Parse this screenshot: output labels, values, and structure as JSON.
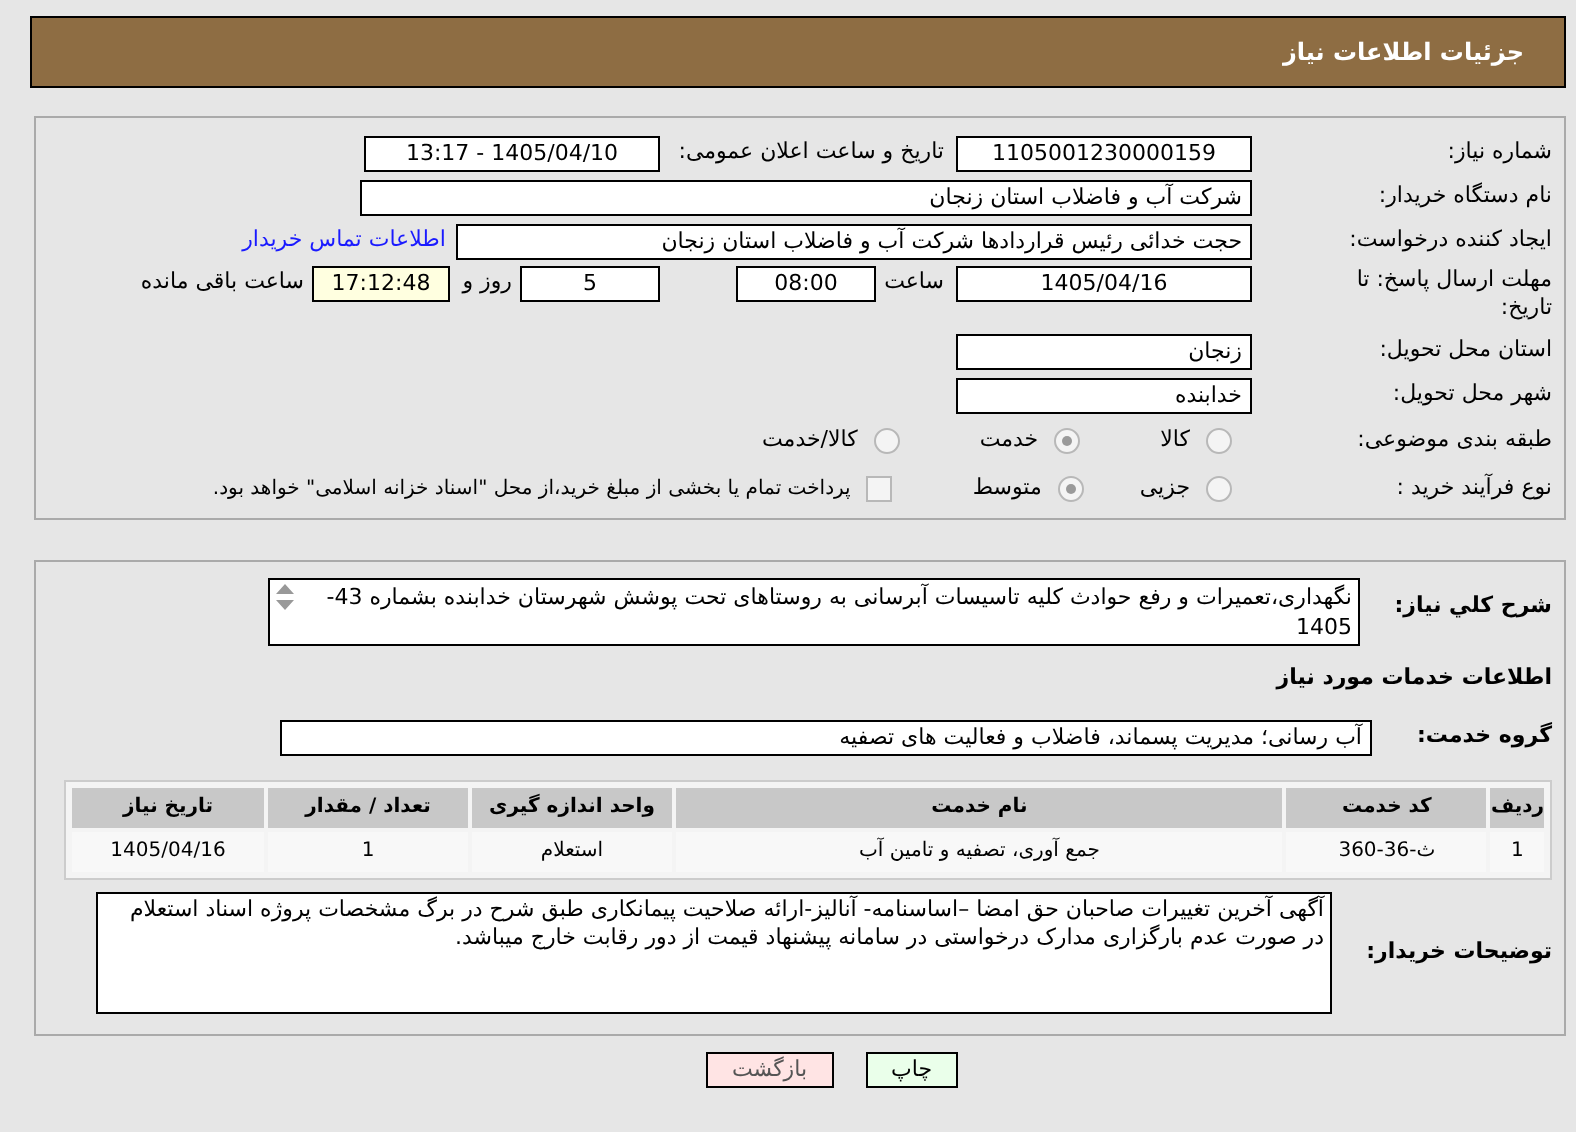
{
  "header": {
    "title": "جزئیات اطلاعات نیاز"
  },
  "need_number": {
    "label": "شماره نیاز:",
    "value": "1105001230000159"
  },
  "announce": {
    "label": "تاریخ و ساعت اعلان عمومی:",
    "value": "1405/04/10 - 13:17"
  },
  "buyer_org": {
    "label": "نام دستگاه خریدار:",
    "value": "شرکت آب و فاضلاب استان زنجان"
  },
  "requester": {
    "label": "ایجاد کننده درخواست:",
    "value": "حجت  خدائی رئیس قراردادها شرکت آب و فاضلاب استان زنجان",
    "link": "اطلاعات تماس خریدار"
  },
  "deadline": {
    "label": "مهلت ارسال پاسخ: تا تاریخ:",
    "date": "1405/04/16",
    "time_label": "ساعت",
    "time": "08:00",
    "days": "5",
    "days_label": "روز و",
    "remaining": "17:12:48",
    "remaining_label": "ساعت باقی مانده"
  },
  "province": {
    "label": "استان محل تحویل:",
    "value": "زنجان"
  },
  "city": {
    "label": "شهر محل تحویل:",
    "value": "خدابنده"
  },
  "category": {
    "label": "طبقه بندی موضوعی:",
    "options": [
      {
        "label": "کالا",
        "selected": false
      },
      {
        "label": "خدمت",
        "selected": true
      },
      {
        "label": "کالا/خدمت",
        "selected": false
      }
    ]
  },
  "process": {
    "label": "نوع فرآیند خرید :",
    "options": [
      {
        "label": "جزیی",
        "selected": false
      },
      {
        "label": "متوسط",
        "selected": true
      }
    ],
    "payment": {
      "label": "پرداخت تمام یا بخشی از مبلغ خرید،از محل \"اسناد خزانه اسلامی\" خواهد بود.",
      "checked": false
    }
  },
  "description": {
    "label": "شرح کلي نیاز:",
    "value": "نگهداری،تعمیرات و رفع حوادث کلیه تاسیسات آبرسانی به روستاهای تحت پوشش شهرستان خدابنده بشماره 43-1405"
  },
  "services_title": "اطلاعات خدمات مورد نیاز",
  "service_group": {
    "label": "گروه خدمت:",
    "value": "آب رسانی؛ مدیریت پسماند، فاضلاب و فعالیت های تصفیه"
  },
  "table": {
    "columns": [
      "ردیف",
      "کد خدمت",
      "نام خدمت",
      "واحد اندازه گیری",
      "تعداد / مقدار",
      "تاریخ نیاز"
    ],
    "rows": [
      [
        "1",
        "ث-36-360",
        "جمع آوری، تصفیه و تامین آب",
        "استعلام",
        "1",
        "1405/04/16"
      ]
    ]
  },
  "buyer_notes": {
    "label": "توضیحات خریدار:",
    "value": "آگهی آخرین تغییرات صاحبان حق امضا –اساسنامه- آنالیز-ارائه صلاحیت پیمانکاری طبق شرح در برگ مشخصات پروژه اسناد استعلام در صورت عدم بارگزاری مدارک درخواستی در سامانه پیشنهاد قیمت از دور رقابت خارج میباشد."
  },
  "buttons": [
    {
      "label": "چاپ",
      "kind": "print"
    },
    {
      "label": "بازگشت",
      "kind": "back"
    }
  ]
}
